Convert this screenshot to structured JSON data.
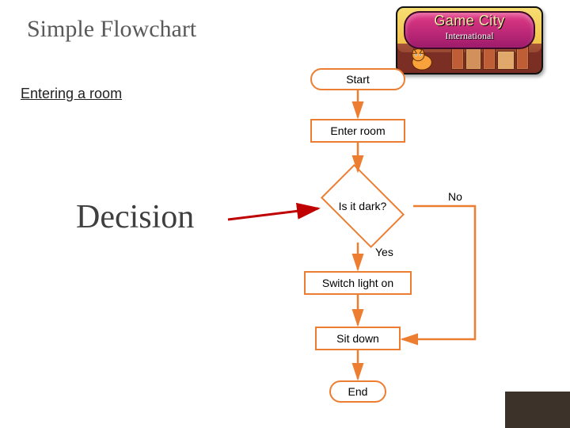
{
  "title": "Simple Flowchart",
  "subtitle": "Entering a room",
  "annotation": "Decision",
  "logo": {
    "line1": "Game City",
    "line2": "International"
  },
  "flow": {
    "start": "Start",
    "enter": "Enter room",
    "decision": "Is it dark?",
    "yes": "Yes",
    "no": "No",
    "switch": "Switch light on",
    "sit": "Sit down",
    "end": "End"
  },
  "colors": {
    "node_border": "#ed7d31",
    "arrow": "#ed7d31",
    "pointer": "#c00000"
  }
}
